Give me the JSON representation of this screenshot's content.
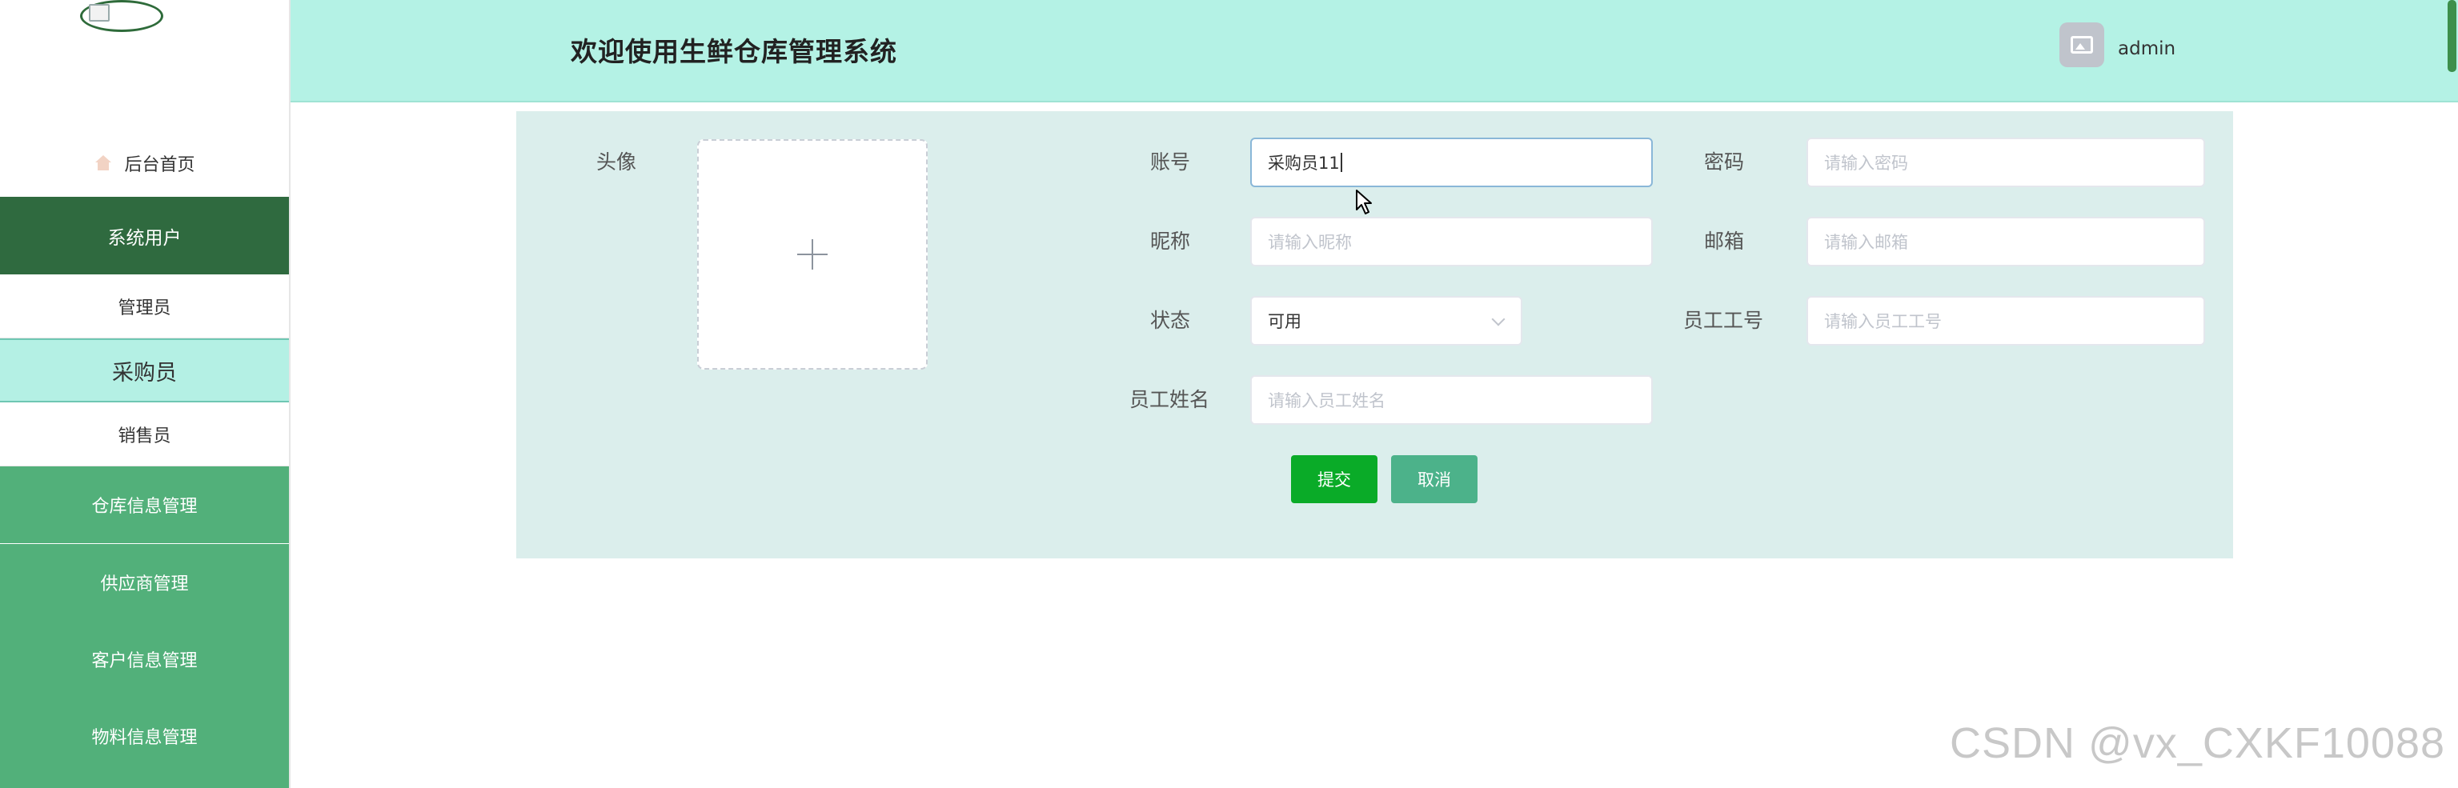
{
  "header": {
    "title": "欢迎使用生鲜仓库管理系统",
    "username": "admin"
  },
  "sidebar": {
    "home": "后台首页",
    "system_users": "系统用户",
    "sub_items": [
      "管理员",
      "采购员",
      "销售员"
    ],
    "menus": [
      "仓库信息管理",
      "供应商管理",
      "客户信息管理",
      "物料信息管理"
    ]
  },
  "form": {
    "avatar_label": "头像",
    "account": {
      "label": "账号",
      "value": "采购员11"
    },
    "password": {
      "label": "密码",
      "placeholder": "请输入密码"
    },
    "nickname": {
      "label": "昵称",
      "placeholder": "请输入昵称"
    },
    "email": {
      "label": "邮箱",
      "placeholder": "请输入邮箱"
    },
    "status": {
      "label": "状态",
      "value": "可用"
    },
    "employee_no": {
      "label": "员工工号",
      "placeholder": "请输入员工工号"
    },
    "employee_name": {
      "label": "员工姓名",
      "placeholder": "请输入员工姓名"
    },
    "submit": "提交",
    "cancel": "取消"
  },
  "watermark": "CSDN @vx_CXKF10088",
  "colors": {
    "header_bg": "#b4f2e5",
    "sidebar_active": "#2f6a3f",
    "sidebar_menu": "#52b07a",
    "submit_btn": "#0aab28",
    "cancel_btn": "#4cb28a"
  }
}
